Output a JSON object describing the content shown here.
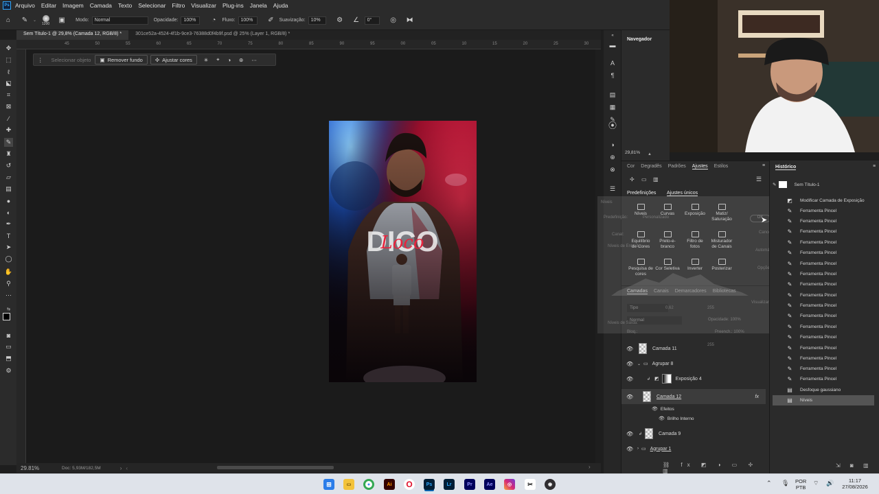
{
  "menu": {
    "items": [
      "Arquivo",
      "Editar",
      "Imagem",
      "Camada",
      "Texto",
      "Selecionar",
      "Filtro",
      "Visualizar",
      "Plug-ins",
      "Janela",
      "Ajuda"
    ]
  },
  "options_bar": {
    "brush_size": "1200",
    "mode_label": "Modo:",
    "mode_value": "Normal",
    "opacity_label": "Opacidade:",
    "opacity_value": "100%",
    "flow_label": "Fluxo:",
    "flow_value": "100%",
    "smoothing_label": "Suavização:",
    "smoothing_value": "10%",
    "angle_value": "0°"
  },
  "tabs": [
    {
      "label": "Sem Título-1 @ 29,8% (Camada 12, RGB/8) *",
      "active": true
    },
    {
      "label": "301ce52a-4524-4f1b-9ce3-76388d0f4b9f.psd @ 25% (Layer 1, RGB/8) *",
      "active": false
    }
  ],
  "ruler_ticks": [
    "45",
    "50",
    "55",
    "60",
    "65",
    "70",
    "75",
    "80",
    "85",
    "90",
    "95",
    "00",
    "05",
    "10",
    "15",
    "20",
    "25",
    "30",
    "35",
    "40"
  ],
  "context_bar": {
    "select_object": "Selecionar objeto",
    "remove_bg": "Remover fundo",
    "adjust_colors": "Ajustar cores"
  },
  "artwork": {
    "title_text": "DICO",
    "script_text": "Loco"
  },
  "status": {
    "zoom": "29.81%",
    "doc": "Doc: 5,93M/182,5M"
  },
  "navigator": {
    "title": "Navegador",
    "zoom": "29,81%"
  },
  "adjust_panel": {
    "tabs": [
      "Cor",
      "Degradês",
      "Padrões",
      "Ajustes",
      "Estilos"
    ],
    "active_tab": "Ajustes",
    "subtabs": [
      "Predefinições",
      "Ajustes únicos"
    ],
    "items": [
      [
        "Níveis"
      ],
      [
        "Curvas"
      ],
      [
        "Exposição"
      ],
      [
        "Matiz/",
        "Saturação"
      ],
      [
        "Equilíbrio",
        "de Cores"
      ],
      [
        "Preto-e-",
        "branco"
      ],
      [
        "Filtro de",
        "fotos"
      ],
      [
        "Misturador",
        "de Canais"
      ],
      [
        "Pesquisa de",
        "cores"
      ],
      [
        "Cor Seletiva"
      ],
      [
        "Inverter"
      ],
      [
        "Posterizar"
      ]
    ]
  },
  "ghost_dialog": {
    "title": "Níveis",
    "preset": "Predefinição:",
    "preset_value": "Personalizado",
    "channel": "Canal:",
    "input_levels": "Níveis de Entrada:",
    "output_levels": "Níveis de Saída:",
    "ok": "OK",
    "cancel": "Cancelar",
    "auto": "Automático",
    "options": "Opções...",
    "preview": "Visualizar",
    "mid": "0,62",
    "high": "255",
    "out_high": "255"
  },
  "layers_panel": {
    "tabs": [
      "Camadas",
      "Canais",
      "Demarcadores",
      "Bibliotecas"
    ],
    "kind": "Tipo",
    "blend": "Normal",
    "opacity": "Opacidade: 100%",
    "lock": "Bloq.:",
    "fill": "Preench.: 100%",
    "layers": [
      {
        "name": "Camada 11",
        "type": "layer"
      },
      {
        "name": "Agrupar 8",
        "type": "group"
      },
      {
        "name": "Exposição 4",
        "type": "adjustment"
      },
      {
        "name": "Camada 12",
        "type": "layer",
        "selected": true,
        "fx": "fx"
      },
      {
        "name": "Efeitos",
        "type": "effects"
      },
      {
        "name": "Brilho Interno",
        "type": "effect"
      },
      {
        "name": "Camada 9",
        "type": "layer"
      },
      {
        "name": "Agrupar 1",
        "type": "group"
      }
    ]
  },
  "history_panel": {
    "title": "Histórico",
    "snapshot": "Sem Título-1",
    "items": [
      "Modificar Camada de Exposição",
      "Ferramenta Pincel",
      "Ferramenta Pincel",
      "Ferramenta Pincel",
      "Ferramenta Pincel",
      "Ferramenta Pincel",
      "Ferramenta Pincel",
      "Ferramenta Pincel",
      "Ferramenta Pincel",
      "Ferramenta Pincel",
      "Ferramenta Pincel",
      "Ferramenta Pincel",
      "Ferramenta Pincel",
      "Ferramenta Pincel",
      "Ferramenta Pincel",
      "Ferramenta Pincel",
      "Ferramenta Pincel",
      "Ferramenta Pincel",
      "Desfoque gaussiano",
      "Níveis"
    ],
    "selected_index": 19
  },
  "taskbar": {
    "apps": [
      "windows-start",
      "file-explorer",
      "chrome",
      "illustrator",
      "opera",
      "photoshop",
      "lightroom",
      "premiere",
      "after-effects",
      "instagram",
      "capcut",
      "obs"
    ],
    "lang_top": "POR",
    "lang_bottom": "PTB",
    "time": "11:17",
    "date": "27/08/2026"
  },
  "colors": {
    "accent": "#31a8ff",
    "panel": "#2b2b2b",
    "canvas": "#1b1b1b"
  }
}
